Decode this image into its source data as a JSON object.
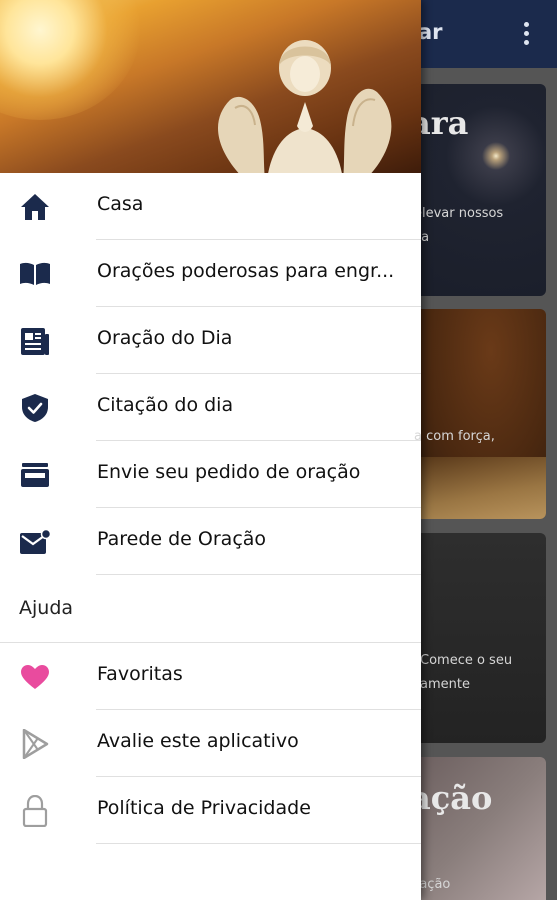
{
  "app_bar": {
    "title_fragment": "ar"
  },
  "background_cards": [
    {
      "title": "ara",
      "text": [
        "elevar nossos",
        "ça"
      ]
    },
    {
      "title": "",
      "text": [
        "a com força,"
      ]
    },
    {
      "title": "",
      "text": [
        "Comece o seu",
        "amente"
      ]
    },
    {
      "title": "ação",
      "text": [
        "ração"
      ]
    }
  ],
  "drawer": {
    "items": [
      {
        "label": "Casa",
        "icon": "home-icon"
      },
      {
        "label": "Orações poderosas para engr...",
        "icon": "book-icon"
      },
      {
        "label": "Oração do Dia",
        "icon": "newspaper-icon"
      },
      {
        "label": "Citação do dia",
        "icon": "shield-check-icon"
      },
      {
        "label": "Envie seu pedido de oração",
        "icon": "inbox-icon"
      },
      {
        "label": "Parede de Oração",
        "icon": "mail-notification-icon"
      }
    ],
    "section_header": "Ajuda",
    "help_items": [
      {
        "label": "Favoritas",
        "icon": "heart-icon"
      },
      {
        "label": "Avalie este aplicativo",
        "icon": "play-store-icon"
      },
      {
        "label": "Política de Privacidade",
        "icon": "lock-icon"
      }
    ]
  },
  "colors": {
    "app_bar": "#1b2a4c",
    "icon_primary": "#1b2a4c",
    "heart": "#e94b9e",
    "icon_grey": "#9e9e9e"
  }
}
